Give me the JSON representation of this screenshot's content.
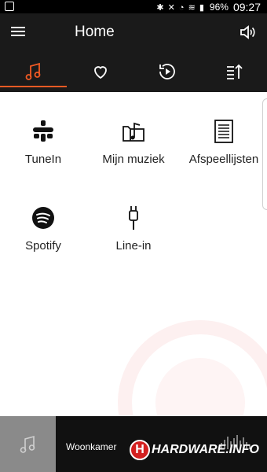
{
  "status_bar": {
    "battery": "96%",
    "time": "09:27"
  },
  "appbar": {
    "title": "Home"
  },
  "tabs": [
    {
      "name": "music",
      "active": true
    },
    {
      "name": "favorites",
      "active": false
    },
    {
      "name": "recent",
      "active": false
    },
    {
      "name": "queue",
      "active": false
    }
  ],
  "sources": [
    {
      "label": "TuneIn",
      "icon": "tunein-icon"
    },
    {
      "label": "Mijn muziek",
      "icon": "music-folder-icon"
    },
    {
      "label": "Afspeellijsten",
      "icon": "playlist-icon"
    },
    {
      "label": "Spotify",
      "icon": "spotify-icon"
    },
    {
      "label": "Line-in",
      "icon": "line-in-icon"
    }
  ],
  "player": {
    "room": "Woonkamer",
    "logo_text": "HARDWARE.INFO"
  },
  "colors": {
    "accent": "#f15a24",
    "bar_bg": "#1a1a1a",
    "status_bg": "#000000"
  }
}
